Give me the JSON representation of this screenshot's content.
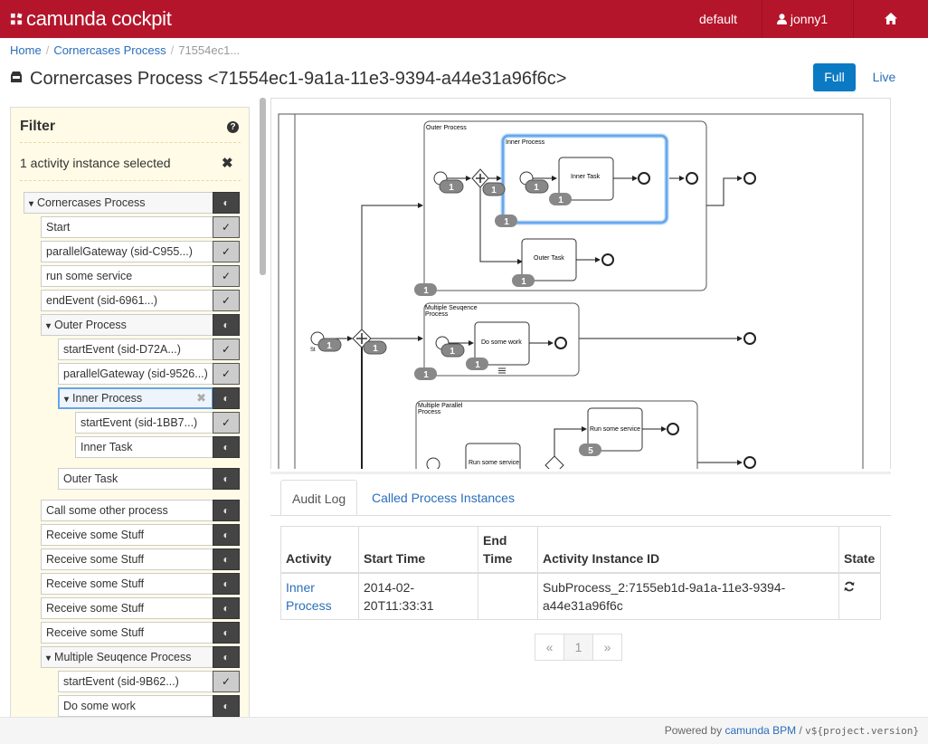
{
  "header": {
    "brand": "camunda cockpit",
    "engine": "default",
    "user": "jonny1"
  },
  "breadcrumb": {
    "home": "Home",
    "process": "Cornercases Process",
    "instance": "71554ec1..."
  },
  "page": {
    "title": "Cornercases Process <71554ec1-9a1a-11e3-9394-a44e31a96f6c>",
    "full_label": "Full",
    "live_label": "Live"
  },
  "filter": {
    "heading": "Filter",
    "help": "?",
    "selection": "1 activity instance selected",
    "tree": [
      {
        "label": "Cornercases Process",
        "chevron": "▾"
      },
      {
        "label": "Start"
      },
      {
        "label": "parallelGateway (sid-C955...)"
      },
      {
        "label": "run some service"
      },
      {
        "label": "endEvent (sid-6961...)"
      },
      {
        "label": "Outer Process",
        "chevron": "▾"
      },
      {
        "label": "startEvent (sid-D72A...)"
      },
      {
        "label": "parallelGateway (sid-9526...)"
      },
      {
        "label": "Inner Process",
        "chevron": "▾"
      },
      {
        "label": "startEvent (sid-1BB7...)"
      },
      {
        "label": "Inner Task"
      },
      {
        "label": "Outer Task"
      },
      {
        "label": "Call some other process"
      },
      {
        "label": "Receive some Stuff"
      },
      {
        "label": "Receive some Stuff"
      },
      {
        "label": "Receive some Stuff"
      },
      {
        "label": "Receive some Stuff"
      },
      {
        "label": "Receive some Stuff"
      },
      {
        "label": "Multiple Seuqence Process",
        "chevron": "▾"
      },
      {
        "label": "startEvent (sid-9B62...)"
      },
      {
        "label": "Do some work"
      }
    ]
  },
  "diagram": {
    "outer_process": "Outer Process",
    "inner_process": "Inner Process",
    "inner_task": "Inner Task",
    "outer_task": "Outer Task",
    "multi_seq_1": "Multiple Seuqence",
    "multi_seq_2": "Process",
    "do_work": "Do some work",
    "multi_par_1": "Multiple Parallel",
    "multi_par_2": "Process",
    "run_service": "Run some service",
    "run_service_2": "Run some service",
    "start_label": "St",
    "badge_1": "1",
    "badge_5": "5"
  },
  "tabs": {
    "audit": "Audit Log",
    "called": "Called Process Instances"
  },
  "audit": {
    "headers": {
      "activity": "Activity",
      "start": "Start Time",
      "end_1": "End",
      "end_2": "Time",
      "id": "Activity Instance ID",
      "state": "State"
    },
    "row": {
      "activity_1": "Inner",
      "activity_2": "Process",
      "start_1": "2014-02-",
      "start_2": "20T11:33:31",
      "end": "",
      "id_1": "SubProcess_2:7155eb1d-9a1a-11e3-9394-",
      "id_2": "a44e31a96f6c"
    }
  },
  "pager": {
    "prev": "«",
    "page": "1",
    "next": "»"
  },
  "footer": {
    "powered": "Powered by",
    "link": "camunda BPM",
    "slash": " / ",
    "version": "v${project.version}"
  }
}
